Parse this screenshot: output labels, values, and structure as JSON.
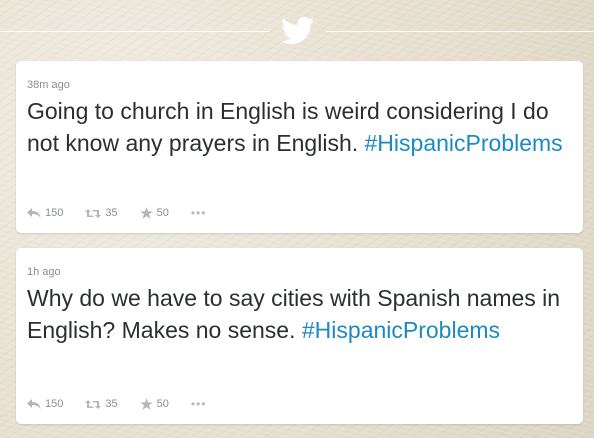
{
  "header": {
    "icon": "twitter-bird-icon",
    "accent": "#1da1f2"
  },
  "tweets": [
    {
      "timestamp": "38m ago",
      "text": "Going to church in English is weird considering I do not know any prayers in English.",
      "hashtag": "#HispanicProblems",
      "replies": "150",
      "retweets": "35",
      "favorites": "50",
      "more": "•••"
    },
    {
      "timestamp": "1h ago",
      "text": "Why do we have to say cities with Spanish names in English? Makes no sense.",
      "hashtag": "#HispanicProblems",
      "replies": "150",
      "retweets": "35",
      "favorites": "50",
      "more": "•••"
    }
  ],
  "colors": {
    "hashtag": "#1b8ac3",
    "text": "#2b2f33",
    "meta": "#8a8f94"
  }
}
